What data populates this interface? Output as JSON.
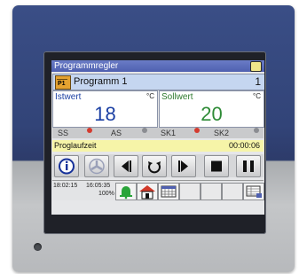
{
  "window": {
    "title": "Programmregler"
  },
  "program": {
    "label": "Programm 1",
    "badge": "P1",
    "number": "1"
  },
  "ist": {
    "label": "Istwert",
    "unit": "°C",
    "value": "18"
  },
  "soll": {
    "label": "Sollwert",
    "unit": "°C",
    "value": "20"
  },
  "status": [
    {
      "label": "SS",
      "led": "#d43b2f"
    },
    {
      "label": "AS",
      "led": "#8b8d92"
    },
    {
      "label": "SK1",
      "led": "#d43b2f"
    },
    {
      "label": "SK2",
      "led": "#8b8d92"
    }
  ],
  "runtime": {
    "label": "Proglaufzeit",
    "value": "00:00:06"
  },
  "toolbar": {
    "buttons": [
      "info-icon",
      "fan-icon",
      "step-back-icon",
      "cycle-icon",
      "step-forward-icon",
      "stop-icon",
      "pause-icon"
    ]
  },
  "footer": {
    "time": "18:02:15",
    "time2": "16:05:35",
    "percent": "100%"
  },
  "colors": {
    "title_bar": "#5566b8",
    "ist_value": "#1a3fa3",
    "soll_value": "#2e8b36",
    "runtime_bg": "#f6f4a8"
  }
}
